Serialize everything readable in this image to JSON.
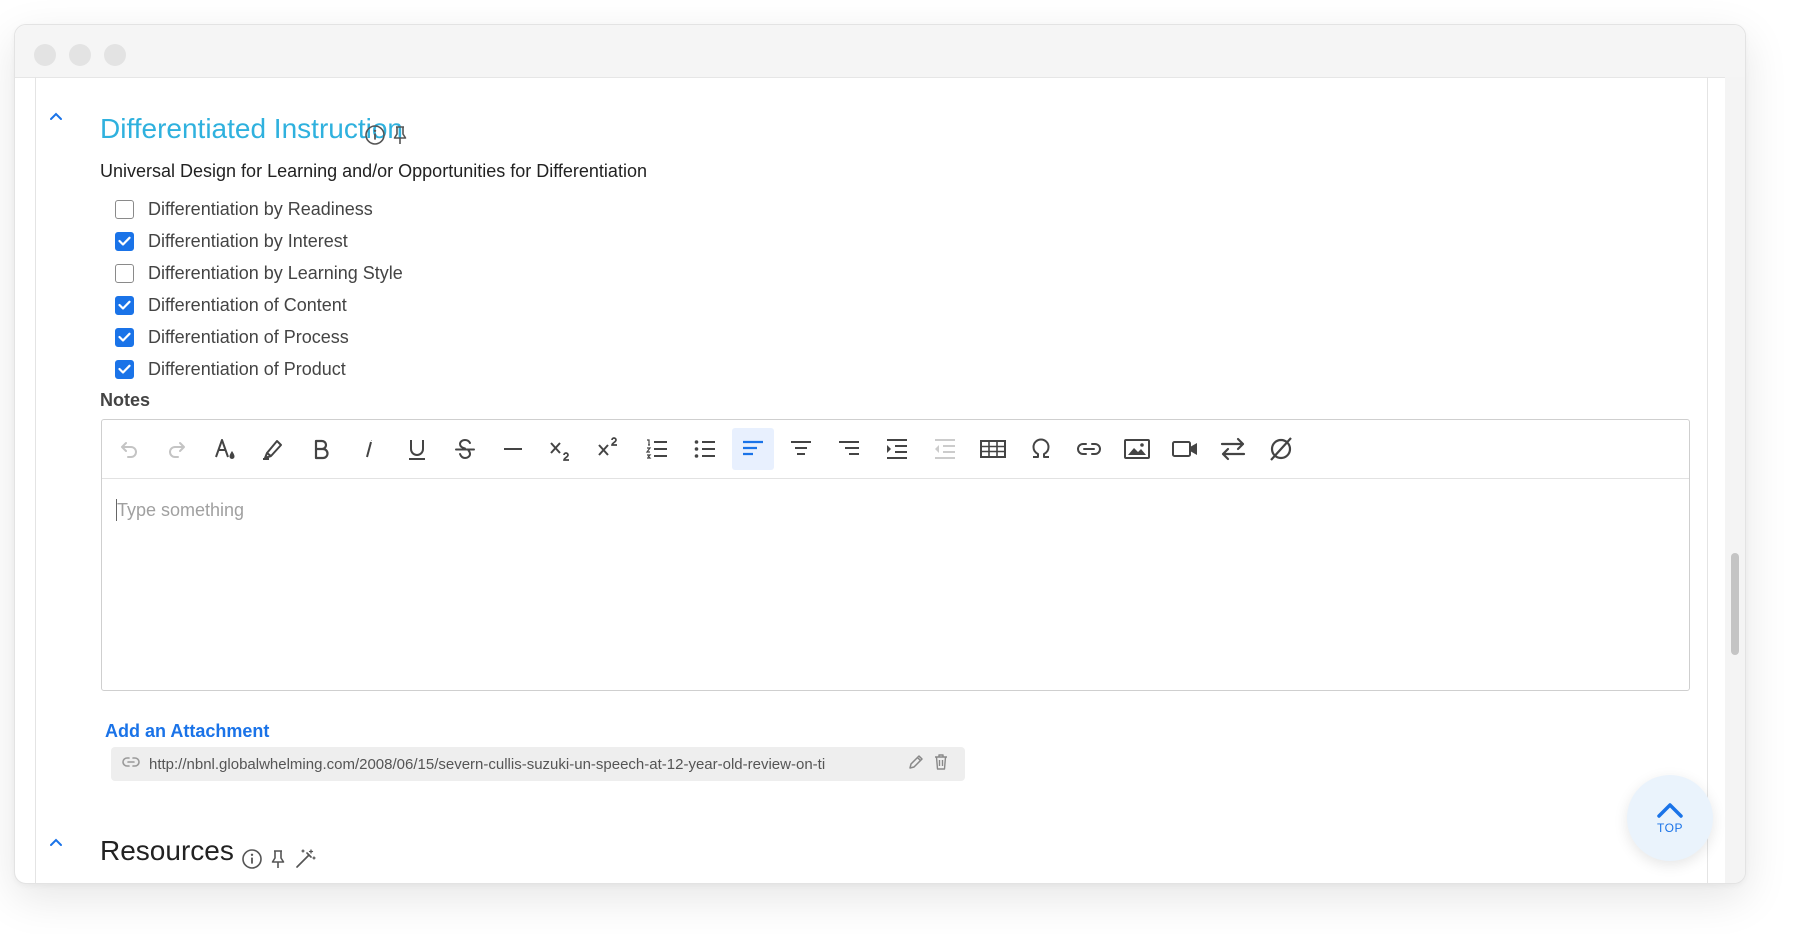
{
  "section": {
    "title": "Differentiated Instruction",
    "subheading": "Universal Design for Learning and/or Opportunities for Differentiation"
  },
  "checkboxes": [
    {
      "label": "Differentiation by Readiness",
      "checked": false
    },
    {
      "label": "Differentiation by Interest",
      "checked": true
    },
    {
      "label": "Differentiation by Learning Style",
      "checked": false
    },
    {
      "label": "Differentiation of Content",
      "checked": true
    },
    {
      "label": "Differentiation of Process",
      "checked": true
    },
    {
      "label": "Differentiation of Product",
      "checked": true
    }
  ],
  "notes": {
    "label": "Notes",
    "placeholder": "Type something",
    "toolbar": [
      "undo-icon",
      "redo-icon",
      "text-color-icon",
      "highlight-icon",
      "bold-icon",
      "italic-icon",
      "underline-icon",
      "strikethrough-icon",
      "horizontal-rule-icon",
      "subscript-icon",
      "superscript-icon",
      "ordered-list-icon",
      "bullet-list-icon",
      "align-left-icon",
      "align-center-icon",
      "align-right-icon",
      "indent-icon",
      "outdent-icon",
      "table-icon",
      "special-character-icon",
      "link-icon",
      "image-icon",
      "video-icon",
      "swap-icon",
      "clear-format-icon"
    ],
    "active_tool": "align-left-icon"
  },
  "attachments": {
    "add_label": "Add an Attachment",
    "items": [
      {
        "url": "http://nbnl.globalwhelming.com/2008/06/15/severn-cullis-suzuki-un-speech-at-12-year-old-review-on-ti"
      }
    ]
  },
  "resources": {
    "title": "Resources"
  },
  "top_button": {
    "label": "TOP"
  },
  "colors": {
    "accent": "#1a73e8",
    "section_title": "#2fb1de"
  }
}
